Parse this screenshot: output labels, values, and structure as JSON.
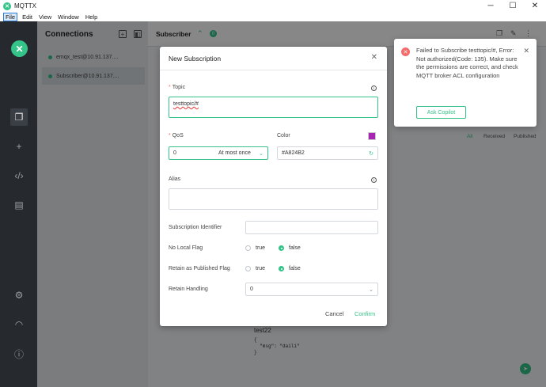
{
  "window": {
    "title": "MQTTX"
  },
  "menu": [
    "File",
    "Edit",
    "View",
    "Window",
    "Help"
  ],
  "connections": {
    "header": "Connections",
    "items": [
      "emqx_test@10.91.137....",
      "Subscriber@10.91.137...."
    ]
  },
  "main": {
    "title": "Subscriber",
    "badge": "0",
    "tabs": [
      "All",
      "Received",
      "Published"
    ],
    "message": {
      "topic": "test22",
      "payload": "{\n  \"msg\": \"daili\"\n}"
    }
  },
  "modal": {
    "title": "New Subscription",
    "topic_label": "Topic",
    "topic_value": "testtopic/#",
    "qos_label": "QoS",
    "qos_value": "0",
    "qos_text": "At most once",
    "color_label": "Color",
    "color_value": "#A824B2",
    "alias_label": "Alias",
    "subid_label": "Subscription Identifier",
    "nolocal_label": "No Local Flag",
    "rap_label": "Retain as Published Flag",
    "true_label": "true",
    "false_label": "false",
    "rh_label": "Retain Handling",
    "rh_value": "0",
    "cancel": "Cancel",
    "confirm": "Confirm"
  },
  "notice": {
    "message": "Failed to Subscribe testtopic/#, Error: Not authorized(Code: 135). Make sure the permissions are correct, and check MQTT broker ACL configuration",
    "button": "Ask Copilot"
  },
  "colors": {
    "accent": "#34c388",
    "error": "#f56c6c",
    "swatch": "#A824B2"
  }
}
